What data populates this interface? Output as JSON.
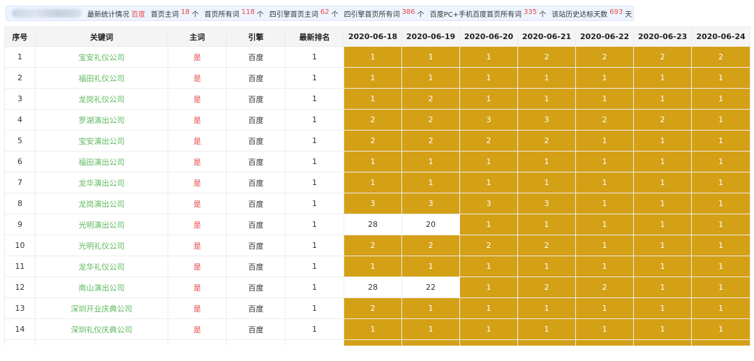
{
  "summary": {
    "title": "最新统计情况",
    "engine": "百度",
    "items": [
      {
        "label": "首页主词",
        "value": "18",
        "unit": "个"
      },
      {
        "label": "首页所有词",
        "value": "118",
        "unit": "个"
      },
      {
        "label": "四引擎首页主词",
        "value": "62",
        "unit": "个"
      },
      {
        "label": "四引擎首页所有词",
        "value": "386",
        "unit": "个"
      },
      {
        "label": "百度PC+手机百度首页所有词",
        "value": "335",
        "unit": "个"
      },
      {
        "label": "该站历史达标天数",
        "value": "693",
        "unit": "天"
      }
    ]
  },
  "table": {
    "headers": [
      "序号",
      "关键词",
      "主词",
      "引擎",
      "最新排名",
      "2020-06-18",
      "2020-06-19",
      "2020-06-20",
      "2020-06-21",
      "2020-06-22",
      "2020-06-23",
      "2020-06-24"
    ],
    "rows": [
      {
        "no": "1",
        "keyword": "宝安礼仪公司",
        "main": "是",
        "engine": "百度",
        "latest": "1",
        "ranks": [
          "1",
          "1",
          "1",
          "2",
          "2",
          "2",
          "2"
        ]
      },
      {
        "no": "2",
        "keyword": "福田礼仪公司",
        "main": "是",
        "engine": "百度",
        "latest": "1",
        "ranks": [
          "1",
          "1",
          "1",
          "1",
          "1",
          "1",
          "1"
        ]
      },
      {
        "no": "3",
        "keyword": "龙岗礼仪公司",
        "main": "是",
        "engine": "百度",
        "latest": "1",
        "ranks": [
          "1",
          "2",
          "1",
          "1",
          "1",
          "1",
          "1"
        ]
      },
      {
        "no": "4",
        "keyword": "罗湖演出公司",
        "main": "是",
        "engine": "百度",
        "latest": "1",
        "ranks": [
          "2",
          "2",
          "3",
          "3",
          "2",
          "2",
          "1"
        ]
      },
      {
        "no": "5",
        "keyword": "宝安演出公司",
        "main": "是",
        "engine": "百度",
        "latest": "1",
        "ranks": [
          "2",
          "2",
          "2",
          "2",
          "1",
          "1",
          "1"
        ]
      },
      {
        "no": "6",
        "keyword": "福田演出公司",
        "main": "是",
        "engine": "百度",
        "latest": "1",
        "ranks": [
          "1",
          "1",
          "1",
          "1",
          "1",
          "1",
          "1"
        ]
      },
      {
        "no": "7",
        "keyword": "龙华演出公司",
        "main": "是",
        "engine": "百度",
        "latest": "1",
        "ranks": [
          "1",
          "1",
          "1",
          "1",
          "1",
          "1",
          "1"
        ]
      },
      {
        "no": "8",
        "keyword": "龙岗演出公司",
        "main": "是",
        "engine": "百度",
        "latest": "1",
        "ranks": [
          "3",
          "3",
          "3",
          "3",
          "1",
          "1",
          "1"
        ]
      },
      {
        "no": "9",
        "keyword": "光明演出公司",
        "main": "是",
        "engine": "百度",
        "latest": "1",
        "ranks": [
          "28",
          "20",
          "1",
          "1",
          "1",
          "1",
          "1"
        ]
      },
      {
        "no": "10",
        "keyword": "光明礼仪公司",
        "main": "是",
        "engine": "百度",
        "latest": "1",
        "ranks": [
          "2",
          "2",
          "2",
          "2",
          "1",
          "1",
          "1"
        ]
      },
      {
        "no": "11",
        "keyword": "龙华礼仪公司",
        "main": "是",
        "engine": "百度",
        "latest": "1",
        "ranks": [
          "1",
          "1",
          "1",
          "1",
          "1",
          "1",
          "1"
        ]
      },
      {
        "no": "12",
        "keyword": "南山演出公司",
        "main": "是",
        "engine": "百度",
        "latest": "1",
        "ranks": [
          "28",
          "22",
          "1",
          "2",
          "2",
          "1",
          "1"
        ]
      },
      {
        "no": "13",
        "keyword": "深圳开业庆典公司",
        "main": "是",
        "engine": "百度",
        "latest": "1",
        "ranks": [
          "2",
          "1",
          "1",
          "1",
          "1",
          "1",
          "1"
        ]
      },
      {
        "no": "14",
        "keyword": "深圳礼仪庆典公司",
        "main": "是",
        "engine": "百度",
        "latest": "1",
        "ranks": [
          "1",
          "1",
          "1",
          "1",
          "1",
          "1",
          "1"
        ]
      }
    ],
    "colors": {
      "top_rank": "#d4a016",
      "other_rank": "#ffffff",
      "keyword": "#5cb85c",
      "main": "#e64a4a"
    }
  }
}
